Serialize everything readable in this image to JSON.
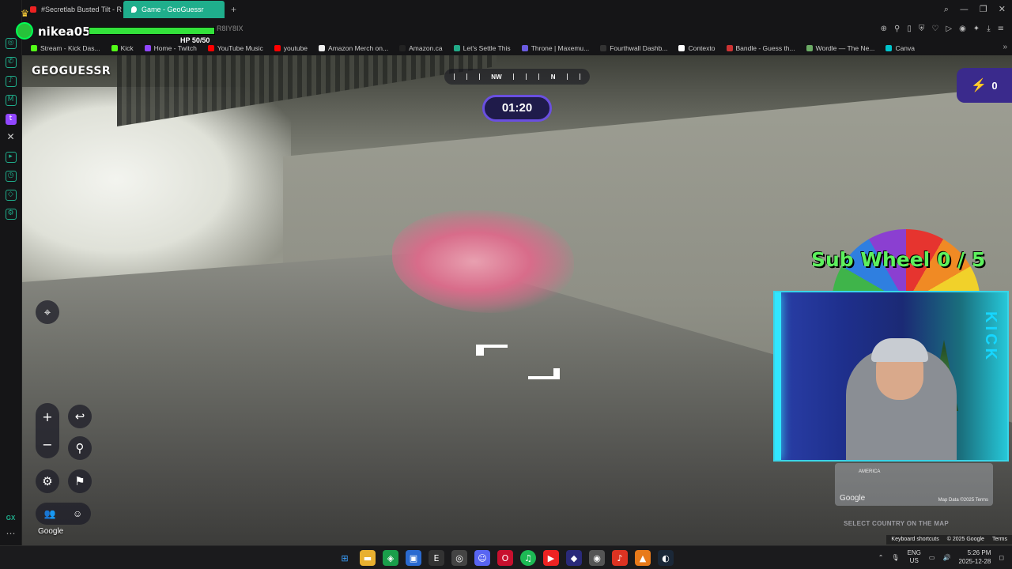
{
  "browser": {
    "tabs": [
      {
        "label": "#Secretlab Busted Tilt - R",
        "active": false
      },
      {
        "label": "Game - GeoGuessr",
        "active": true
      }
    ],
    "new_tab": "+",
    "bookmarks": [
      "Stream - Kick Das...",
      "Kick",
      "Home - Twitch",
      "YouTube Music",
      "youtube",
      "Amazon Merch on...",
      "Amazon.ca",
      "Let's Settle This",
      "Throne | Maxemu...",
      "Fourthwall Dashb...",
      "Contexto",
      "Bandle - Guess th...",
      "Wordle — The Ne...",
      "Canva"
    ],
    "url_fragment": "R8IY8IX",
    "rail_gx": "GX"
  },
  "game": {
    "logo": "GEOGUESSR",
    "compass": {
      "nw": "NW",
      "n": "N"
    },
    "timer": "01:20",
    "streak": "0",
    "zoom_in": "+",
    "zoom_out": "−",
    "google_watermark": "Google",
    "minimap": {
      "region": "AMERICA",
      "google": "Google",
      "map_data": "Map Data ©2025",
      "terms": "Terms"
    },
    "select_country": "SELECT COUNTRY ON THE MAP",
    "footer": {
      "shortcuts": "Keyboard shortcuts",
      "copyright": "© 2025 Google",
      "terms": "Terms"
    }
  },
  "overlay": {
    "username": "nikea05",
    "hp_text": "HP 50/50",
    "hp_fraction": 1.0,
    "sub_wheel": "Sub Wheel 0 / 5",
    "webcam_logo": "KICK"
  },
  "taskbar": {
    "lang": "ENG",
    "region": "US",
    "time": "5:26 PM",
    "date": "2025-12-28"
  }
}
